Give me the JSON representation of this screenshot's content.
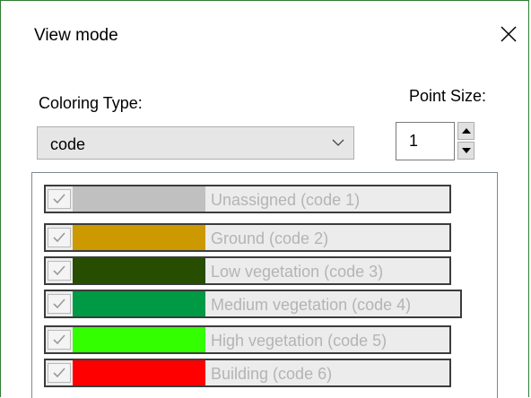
{
  "dialog": {
    "title": "View mode",
    "close_icon": "close-icon"
  },
  "coloring": {
    "label": "Coloring Type:",
    "selected": "code",
    "dropdown_icon": "chevron-down-icon"
  },
  "point_size": {
    "label": "Point Size:",
    "value": "1",
    "up_icon": "triangle-up-icon",
    "down_icon": "triangle-down-icon"
  },
  "classes": [
    {
      "label": "Unassigned (code 1)",
      "color": "#c0c0c0",
      "checked": true
    },
    {
      "label": "Ground (code 2)",
      "color": "#cc9900",
      "checked": true
    },
    {
      "label": "Low vegetation (code 3)",
      "color": "#264d00",
      "checked": true
    },
    {
      "label": "Medium vegetation (code 4)",
      "color": "#009944",
      "checked": true
    },
    {
      "label": "High vegetation (code 5)",
      "color": "#33ff00",
      "checked": true
    },
    {
      "label": "Building (code 6)",
      "color": "#ff0000",
      "checked": true
    }
  ]
}
